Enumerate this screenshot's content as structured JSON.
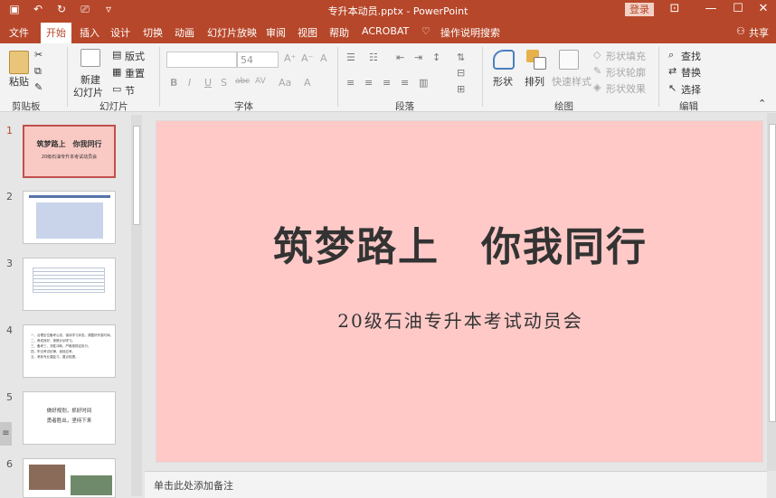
{
  "titlebar": {
    "title": "专升本动员.pptx  -  PowerPoint",
    "login": "登录",
    "qat_icons": [
      "save-icon",
      "undo-icon",
      "redo-icon",
      "slideshow-icon",
      "customize-icon"
    ],
    "color": "#b7472a"
  },
  "tabs": [
    {
      "label": "文件"
    },
    {
      "label": "开始"
    },
    {
      "label": "插入"
    },
    {
      "label": "设计"
    },
    {
      "label": "切换"
    },
    {
      "label": "动画"
    },
    {
      "label": "幻灯片放映"
    },
    {
      "label": "审阅"
    },
    {
      "label": "视图"
    },
    {
      "label": "帮助"
    },
    {
      "label": "ACROBAT"
    },
    {
      "label": "操作说明搜索"
    }
  ],
  "share": "共享",
  "ribbon": {
    "clipboard": {
      "paste": "粘贴",
      "group": "剪贴板"
    },
    "slides": {
      "new_slide": "新建",
      "new_slide2": "幻灯片",
      "layout": "版式",
      "reset": "重置",
      "section": "节",
      "group": "幻灯片"
    },
    "font": {
      "size": "54",
      "group": "字体",
      "buttons": [
        "B",
        "I",
        "U",
        "S",
        "abc",
        "AV",
        "Aa",
        "A"
      ]
    },
    "paragraph": {
      "group": "段落"
    },
    "drawing": {
      "shapes": "形状",
      "arrange": "排列",
      "quick_styles": "快速样式",
      "fill": "形状填充",
      "outline": "形状轮廓",
      "effects": "形状效果",
      "group": "绘图"
    },
    "editing": {
      "find": "查找",
      "replace": "替换",
      "select": "选择",
      "group": "编辑"
    }
  },
  "thumbnails": [
    {
      "num": "1",
      "title": "筑梦路上　你我同行",
      "sub": "20级石油专升本考试动员会"
    },
    {
      "num": "2"
    },
    {
      "num": "3"
    },
    {
      "num": "4",
      "lines": [
        "一、合理定位备考心态，保持学习状态，调整好作息时间。",
        "二、养成良好，按照计划学习。",
        "三、备考三，决胜冲刺，严格按规定执行。",
        "四、牢记考试纪律，诚信应考。",
        "五、考前专业课复习，要点梳理。"
      ]
    },
    {
      "num": "5",
      "lines": [
        "做好规划，抓好时间",
        "勇者胜出，坚持下来"
      ]
    },
    {
      "num": "6"
    }
  ],
  "slide": {
    "title": "筑梦路上　你我同行",
    "subtitle": "20级石油专升本考试动员会",
    "background": "#fec9c7"
  },
  "notes_placeholder": "单击此处添加备注"
}
